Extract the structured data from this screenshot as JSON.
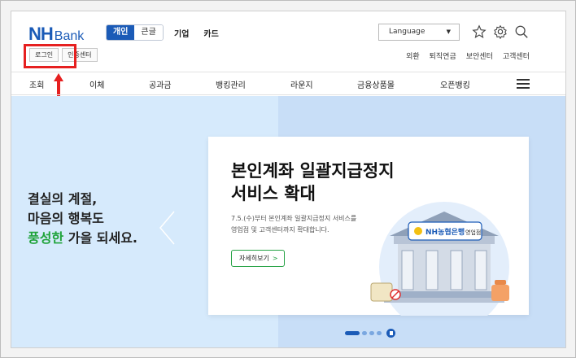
{
  "logo": {
    "nh": "NH",
    "bank": "Bank"
  },
  "segment": {
    "personal": "개인",
    "large_text": "큰글"
  },
  "topnav": {
    "corporate": "기업",
    "card": "카드"
  },
  "language": {
    "label": "Language"
  },
  "login": {
    "login": "로그인",
    "cert": "인증센터"
  },
  "utilnav": [
    "외환",
    "퇴직연금",
    "보안센터",
    "고객센터"
  ],
  "gnb": [
    "조회",
    "이체",
    "공과금",
    "뱅킹관리",
    "라운지",
    "금융상품몰",
    "오픈뱅킹"
  ],
  "banner": {
    "left_line1": "결실의 계절,",
    "left_line2": "마음의 행복도",
    "left_green": "풍성한",
    "left_line3_rest": " 가을 되세요.",
    "card_title_1": "본인계좌 일괄지급정지",
    "card_title_2": "서비스 확대",
    "card_desc_1": "7.5.(수)부터 본인계좌 일괄지급정지 서비스를",
    "card_desc_2": "영업점 및 고객센터까지 확대합니다.",
    "card_button": "자세히보기",
    "sign_text": "NH농협은행",
    "sign_branch": "영업점"
  },
  "colors": {
    "brand": "#1b5bb7",
    "highlight": "#e62020",
    "green": "#1fa33a"
  },
  "icons": [
    "star-icon",
    "gear-icon",
    "search-icon",
    "menu-icon",
    "chevron-left-icon",
    "arrow-up-icon"
  ]
}
